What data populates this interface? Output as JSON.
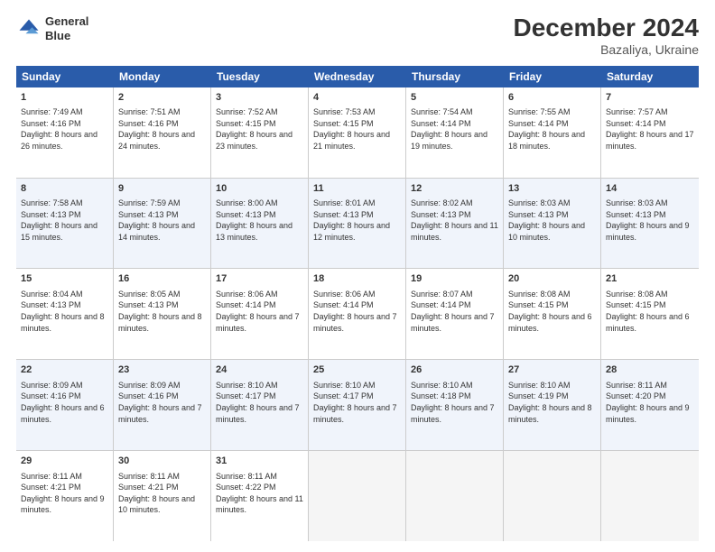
{
  "header": {
    "logo_line1": "General",
    "logo_line2": "Blue",
    "title": "December 2024",
    "subtitle": "Bazaliya, Ukraine"
  },
  "days": [
    "Sunday",
    "Monday",
    "Tuesday",
    "Wednesday",
    "Thursday",
    "Friday",
    "Saturday"
  ],
  "weeks": [
    [
      {
        "num": "1",
        "sunrise": "Sunrise: 7:49 AM",
        "sunset": "Sunset: 4:16 PM",
        "daylight": "Daylight: 8 hours and 26 minutes."
      },
      {
        "num": "2",
        "sunrise": "Sunrise: 7:51 AM",
        "sunset": "Sunset: 4:16 PM",
        "daylight": "Daylight: 8 hours and 24 minutes."
      },
      {
        "num": "3",
        "sunrise": "Sunrise: 7:52 AM",
        "sunset": "Sunset: 4:15 PM",
        "daylight": "Daylight: 8 hours and 23 minutes."
      },
      {
        "num": "4",
        "sunrise": "Sunrise: 7:53 AM",
        "sunset": "Sunset: 4:15 PM",
        "daylight": "Daylight: 8 hours and 21 minutes."
      },
      {
        "num": "5",
        "sunrise": "Sunrise: 7:54 AM",
        "sunset": "Sunset: 4:14 PM",
        "daylight": "Daylight: 8 hours and 19 minutes."
      },
      {
        "num": "6",
        "sunrise": "Sunrise: 7:55 AM",
        "sunset": "Sunset: 4:14 PM",
        "daylight": "Daylight: 8 hours and 18 minutes."
      },
      {
        "num": "7",
        "sunrise": "Sunrise: 7:57 AM",
        "sunset": "Sunset: 4:14 PM",
        "daylight": "Daylight: 8 hours and 17 minutes."
      }
    ],
    [
      {
        "num": "8",
        "sunrise": "Sunrise: 7:58 AM",
        "sunset": "Sunset: 4:13 PM",
        "daylight": "Daylight: 8 hours and 15 minutes."
      },
      {
        "num": "9",
        "sunrise": "Sunrise: 7:59 AM",
        "sunset": "Sunset: 4:13 PM",
        "daylight": "Daylight: 8 hours and 14 minutes."
      },
      {
        "num": "10",
        "sunrise": "Sunrise: 8:00 AM",
        "sunset": "Sunset: 4:13 PM",
        "daylight": "Daylight: 8 hours and 13 minutes."
      },
      {
        "num": "11",
        "sunrise": "Sunrise: 8:01 AM",
        "sunset": "Sunset: 4:13 PM",
        "daylight": "Daylight: 8 hours and 12 minutes."
      },
      {
        "num": "12",
        "sunrise": "Sunrise: 8:02 AM",
        "sunset": "Sunset: 4:13 PM",
        "daylight": "Daylight: 8 hours and 11 minutes."
      },
      {
        "num": "13",
        "sunrise": "Sunrise: 8:03 AM",
        "sunset": "Sunset: 4:13 PM",
        "daylight": "Daylight: 8 hours and 10 minutes."
      },
      {
        "num": "14",
        "sunrise": "Sunrise: 8:03 AM",
        "sunset": "Sunset: 4:13 PM",
        "daylight": "Daylight: 8 hours and 9 minutes."
      }
    ],
    [
      {
        "num": "15",
        "sunrise": "Sunrise: 8:04 AM",
        "sunset": "Sunset: 4:13 PM",
        "daylight": "Daylight: 8 hours and 8 minutes."
      },
      {
        "num": "16",
        "sunrise": "Sunrise: 8:05 AM",
        "sunset": "Sunset: 4:13 PM",
        "daylight": "Daylight: 8 hours and 8 minutes."
      },
      {
        "num": "17",
        "sunrise": "Sunrise: 8:06 AM",
        "sunset": "Sunset: 4:14 PM",
        "daylight": "Daylight: 8 hours and 7 minutes."
      },
      {
        "num": "18",
        "sunrise": "Sunrise: 8:06 AM",
        "sunset": "Sunset: 4:14 PM",
        "daylight": "Daylight: 8 hours and 7 minutes."
      },
      {
        "num": "19",
        "sunrise": "Sunrise: 8:07 AM",
        "sunset": "Sunset: 4:14 PM",
        "daylight": "Daylight: 8 hours and 7 minutes."
      },
      {
        "num": "20",
        "sunrise": "Sunrise: 8:08 AM",
        "sunset": "Sunset: 4:15 PM",
        "daylight": "Daylight: 8 hours and 6 minutes."
      },
      {
        "num": "21",
        "sunrise": "Sunrise: 8:08 AM",
        "sunset": "Sunset: 4:15 PM",
        "daylight": "Daylight: 8 hours and 6 minutes."
      }
    ],
    [
      {
        "num": "22",
        "sunrise": "Sunrise: 8:09 AM",
        "sunset": "Sunset: 4:16 PM",
        "daylight": "Daylight: 8 hours and 6 minutes."
      },
      {
        "num": "23",
        "sunrise": "Sunrise: 8:09 AM",
        "sunset": "Sunset: 4:16 PM",
        "daylight": "Daylight: 8 hours and 7 minutes."
      },
      {
        "num": "24",
        "sunrise": "Sunrise: 8:10 AM",
        "sunset": "Sunset: 4:17 PM",
        "daylight": "Daylight: 8 hours and 7 minutes."
      },
      {
        "num": "25",
        "sunrise": "Sunrise: 8:10 AM",
        "sunset": "Sunset: 4:17 PM",
        "daylight": "Daylight: 8 hours and 7 minutes."
      },
      {
        "num": "26",
        "sunrise": "Sunrise: 8:10 AM",
        "sunset": "Sunset: 4:18 PM",
        "daylight": "Daylight: 8 hours and 7 minutes."
      },
      {
        "num": "27",
        "sunrise": "Sunrise: 8:10 AM",
        "sunset": "Sunset: 4:19 PM",
        "daylight": "Daylight: 8 hours and 8 minutes."
      },
      {
        "num": "28",
        "sunrise": "Sunrise: 8:11 AM",
        "sunset": "Sunset: 4:20 PM",
        "daylight": "Daylight: 8 hours and 9 minutes."
      }
    ],
    [
      {
        "num": "29",
        "sunrise": "Sunrise: 8:11 AM",
        "sunset": "Sunset: 4:21 PM",
        "daylight": "Daylight: 8 hours and 9 minutes."
      },
      {
        "num": "30",
        "sunrise": "Sunrise: 8:11 AM",
        "sunset": "Sunset: 4:21 PM",
        "daylight": "Daylight: 8 hours and 10 minutes."
      },
      {
        "num": "31",
        "sunrise": "Sunrise: 8:11 AM",
        "sunset": "Sunset: 4:22 PM",
        "daylight": "Daylight: 8 hours and 11 minutes."
      },
      null,
      null,
      null,
      null
    ]
  ]
}
